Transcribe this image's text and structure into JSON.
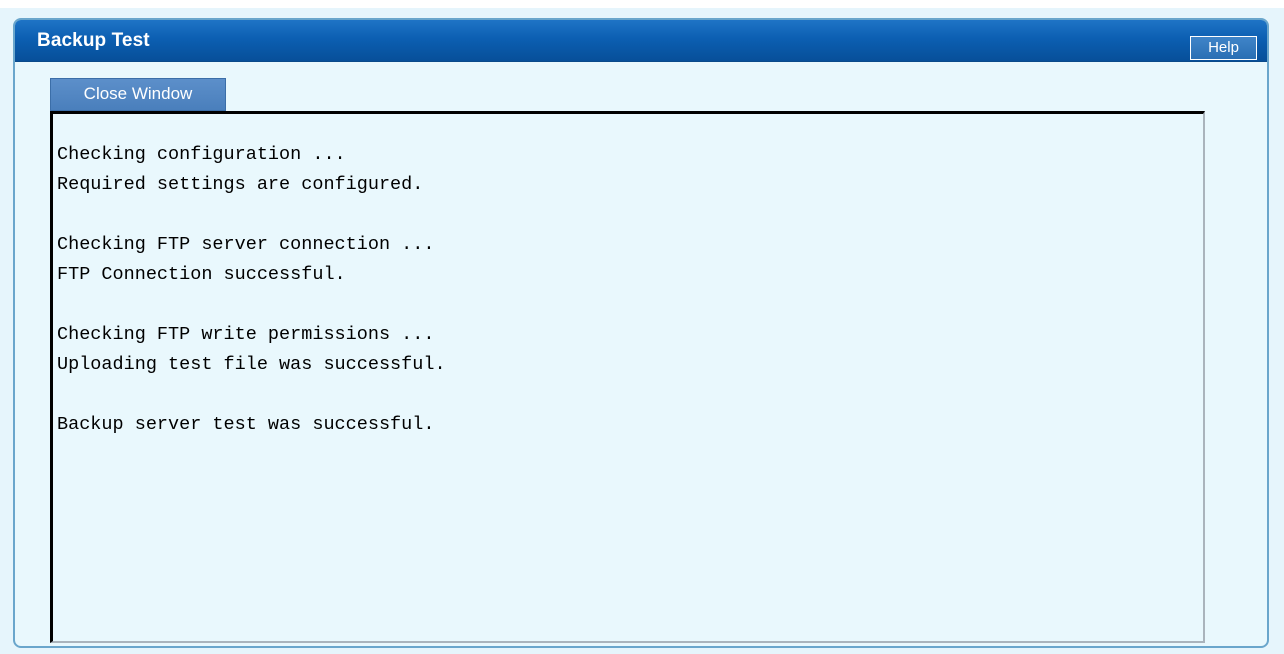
{
  "window": {
    "title": "Backup Test",
    "help_label": "Help",
    "close_label": "Close Window"
  },
  "log": {
    "lines": [
      "Checking configuration ...",
      "Required settings are configured.",
      "",
      "Checking FTP server connection ...",
      "FTP Connection successful.",
      "",
      "Checking FTP write permissions ...",
      "Uploading test file was successful.",
      "",
      "Backup server test was successful."
    ]
  },
  "colors": {
    "titlebar": "#0c5fb2",
    "panel_bg": "#e9f8fd",
    "panel_border": "#6aa6cc",
    "button_bg": "#4a7fbc"
  }
}
